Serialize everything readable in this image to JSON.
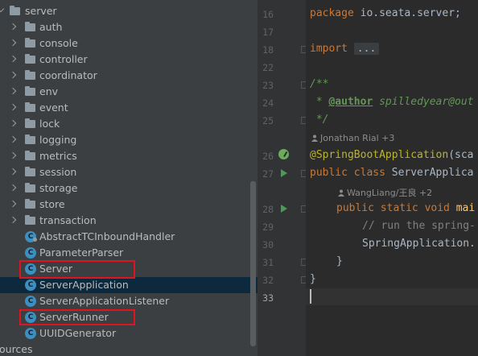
{
  "tree": {
    "root": "server",
    "folders": [
      "auth",
      "console",
      "controller",
      "coordinator",
      "env",
      "event",
      "lock",
      "logging",
      "metrics",
      "session",
      "storage",
      "store",
      "transaction"
    ],
    "classes": [
      "AbstractTCInboundHandler",
      "ParameterParser",
      "Server",
      "ServerApplication",
      "ServerApplicationListener",
      "ServerRunner",
      "UUIDGenerator"
    ],
    "selected": "ServerApplication",
    "highlighted": [
      "Server",
      "ServerRunner"
    ],
    "bottom_partial": "ources",
    "class_icon_letter": "C"
  },
  "editor": {
    "line_numbers": [
      "16",
      "17",
      "18",
      "22",
      "23",
      "24",
      "25",
      "26",
      "27",
      "28",
      "29",
      "30",
      "31",
      "32",
      "33"
    ],
    "current_line": "33",
    "hint_author_1": "Jonathan Rial +3",
    "hint_author_2": "WangLiang/王良 +2",
    "code": {
      "l16_kw": "package",
      "l16_rest": " io.seata.server;",
      "l18_kw": "import",
      "l18_fold": "...",
      "l23": "/**",
      "l24_star": " * ",
      "l24_tag": "@author",
      "l24_rest": " spilledyear@out",
      "l25": " */",
      "l26_ann": "@SpringBootApplication",
      "l26_rest": "(sca",
      "l27_kw": "public class",
      "l27_rest": " ServerApplica",
      "l28_kw": "public static void",
      "l28_fn": " mai",
      "l29": "// run the spring-",
      "l30": "SpringApplication.",
      "l31": "}",
      "l32": "}"
    }
  },
  "colors": {
    "highlight_box": "#e0141e",
    "selection": "#0d293e",
    "keyword": "#cc7832",
    "annotation": "#bbb529",
    "doc_comment": "#629755",
    "run_gutter": "#499c54"
  }
}
